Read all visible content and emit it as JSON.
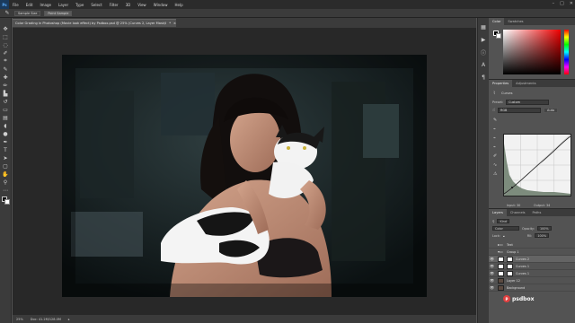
{
  "app": {
    "logo": "Ps"
  },
  "menu": [
    "File",
    "Edit",
    "Image",
    "Layer",
    "Type",
    "Select",
    "Filter",
    "3D",
    "View",
    "Window",
    "Help"
  ],
  "window_controls": [
    "–",
    "□",
    "✕"
  ],
  "options_bar": {
    "buttons": [
      "Sample Size",
      "Point Sample"
    ]
  },
  "document": {
    "tab_title": "Color Grading in Photoshop (Movie look effect) by Psdbox.psd @ 25% (Curves 2, Layer Mask/8)",
    "tab_modified": "*",
    "tab_close": "×"
  },
  "status_bar": {
    "zoom": "25%",
    "doc_size": "Doc: 41.2M/128.0M"
  },
  "color_panel": {
    "tabs": [
      "Color",
      "Swatches"
    ]
  },
  "properties_panel": {
    "tabs": [
      "Properties",
      "Adjustments"
    ],
    "title": "Curves",
    "preset_label": "Preset:",
    "preset_value": "Custom",
    "channel_value": "RGB",
    "auto_label": "Auto",
    "input_label": "Input: 30",
    "output_label": "Output: 34"
  },
  "layers_panel": {
    "tabs": [
      "Layers",
      "Channels",
      "Paths"
    ],
    "kind_label": "Kind",
    "blend_mode": "Color",
    "opacity_label": "Opacity:",
    "opacity_value": "100%",
    "lock_label": "Lock:",
    "fill_label": "Fill:",
    "fill_value": "100%",
    "layers": [
      {
        "name": "Text",
        "type": "group",
        "visible": false,
        "selected": false
      },
      {
        "name": "Group 1",
        "type": "group",
        "visible": false,
        "selected": false
      },
      {
        "name": "Curves 2",
        "type": "adjust",
        "visible": true,
        "selected": true
      },
      {
        "name": "Curves 1",
        "type": "adjust",
        "visible": true,
        "selected": false
      },
      {
        "name": "Curves 1",
        "type": "adjust",
        "visible": true,
        "selected": false
      },
      {
        "name": "Layer 12",
        "type": "photo",
        "visible": true,
        "selected": false
      },
      {
        "name": "Background",
        "type": "photo",
        "visible": true,
        "selected": false
      }
    ]
  },
  "watermark": {
    "text": "psdbox",
    "logo": "P"
  },
  "colors": {
    "menubar": "#2b2b2b",
    "panel": "#535353",
    "canvas_bg": "#282828",
    "accent": "#5fb0ff"
  },
  "tools": [
    "move-icon",
    "marquee-icon",
    "lasso-icon",
    "quick-select-icon",
    "crop-icon",
    "eyedropper-icon",
    "healing-icon",
    "brush-icon",
    "stamp-icon",
    "history-brush-icon",
    "eraser-icon",
    "gradient-icon",
    "blur-icon",
    "dodge-icon",
    "pen-icon",
    "type-icon",
    "path-select-icon",
    "shape-icon",
    "hand-icon",
    "zoom-icon"
  ]
}
